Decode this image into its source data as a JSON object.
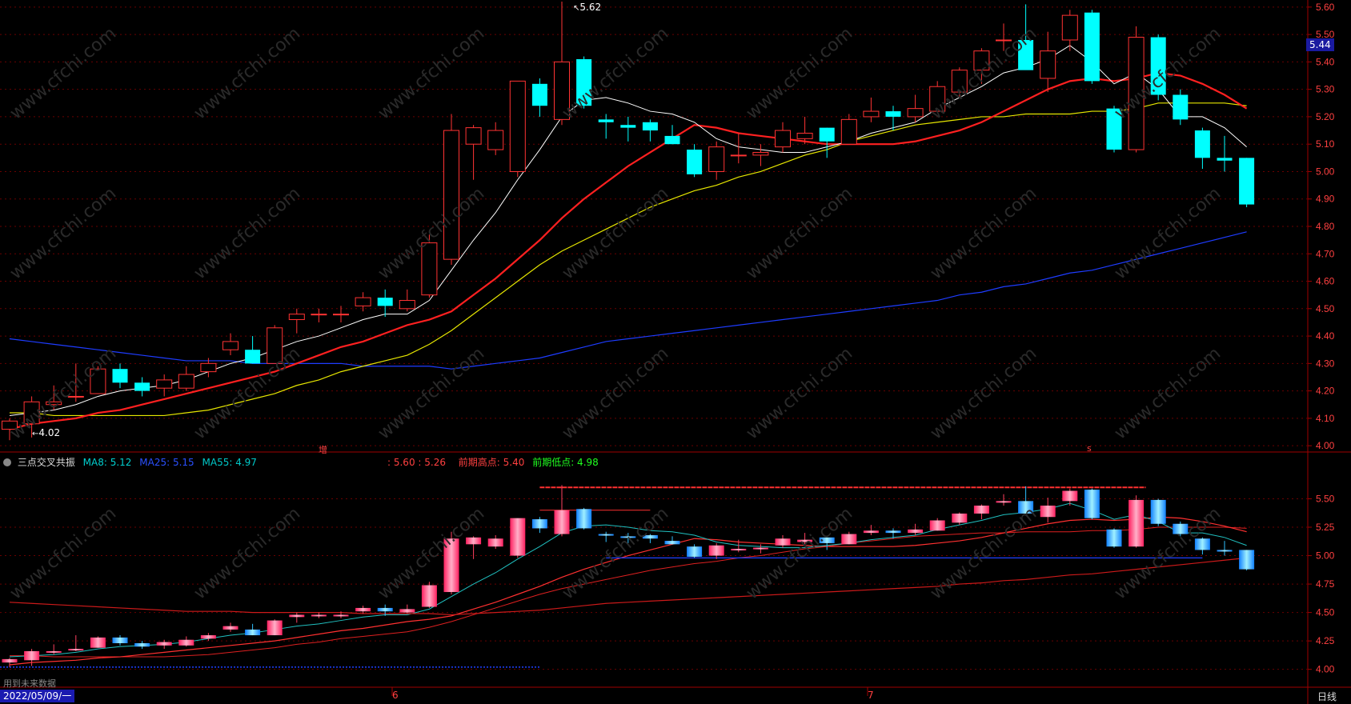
{
  "colors": {
    "up": "#ff3333",
    "down": "#00ffff",
    "ma_white": "#ffffff",
    "ma_red": "#ff2020",
    "ma_yellow": "#e6e600",
    "ma_blue": "#1e3cff",
    "grid": "#6a0000",
    "frame": "#a00000"
  },
  "header": {
    "indicator_name": "三点交叉共振",
    "ma8_label": "MA8: 5.12",
    "ma25_label": "MA25: 5.15",
    "ma55_label": "MA55: 4.97",
    "range_label": ": 5.60 : 5.26",
    "prev_high_label": "前期高点: 5.40",
    "prev_low_label": "前期低点: 4.98"
  },
  "price_badge": "5.44",
  "markers": {
    "high_label": "5.62",
    "low_label": "4.02",
    "signal_zeng": "增",
    "signal_s": "s"
  },
  "footer": {
    "note": "用到未来数据",
    "start_date": "2022/05/09/一",
    "month6": "6",
    "month7": "7",
    "period": "日线"
  },
  "chart_data": [
    {
      "type": "candlestick",
      "panel": "main",
      "ylim": [
        3.98,
        5.62
      ],
      "yticks": [
        4.0,
        4.1,
        4.2,
        4.3,
        4.4,
        4.5,
        4.6,
        4.7,
        4.8,
        4.9,
        5.0,
        5.1,
        5.2,
        5.3,
        5.4,
        5.5,
        5.6
      ],
      "ohlc": [
        [
          4.06,
          4.1,
          4.02,
          4.09
        ],
        [
          4.08,
          4.18,
          4.03,
          4.16
        ],
        [
          4.15,
          4.22,
          4.13,
          4.16
        ],
        [
          4.18,
          4.3,
          4.16,
          4.18
        ],
        [
          4.19,
          4.29,
          4.19,
          4.28
        ],
        [
          4.28,
          4.3,
          4.21,
          4.23
        ],
        [
          4.23,
          4.25,
          4.18,
          4.2
        ],
        [
          4.21,
          4.26,
          4.18,
          4.24
        ],
        [
          4.21,
          4.29,
          4.2,
          4.26
        ],
        [
          4.27,
          4.32,
          4.25,
          4.3
        ],
        [
          4.35,
          4.41,
          4.33,
          4.38
        ],
        [
          4.35,
          4.4,
          4.3,
          4.3
        ],
        [
          4.3,
          4.44,
          4.3,
          4.43
        ],
        [
          4.46,
          4.5,
          4.41,
          4.48
        ],
        [
          4.48,
          4.5,
          4.45,
          4.48
        ],
        [
          4.48,
          4.51,
          4.45,
          4.48
        ],
        [
          4.51,
          4.56,
          4.49,
          4.54
        ],
        [
          4.54,
          4.57,
          4.47,
          4.51
        ],
        [
          4.5,
          4.57,
          4.49,
          4.53
        ],
        [
          4.55,
          4.77,
          4.54,
          4.74
        ],
        [
          4.68,
          5.21,
          4.66,
          5.15
        ],
        [
          5.1,
          5.17,
          4.97,
          5.16
        ],
        [
          5.08,
          5.18,
          5.06,
          5.15
        ],
        [
          5.0,
          5.21,
          4.98,
          5.33
        ],
        [
          5.32,
          5.34,
          5.2,
          5.24
        ],
        [
          5.19,
          5.62,
          5.17,
          5.4
        ],
        [
          5.41,
          5.42,
          5.23,
          5.24
        ],
        [
          5.19,
          5.21,
          5.12,
          5.18
        ],
        [
          5.17,
          5.2,
          5.11,
          5.16
        ],
        [
          5.18,
          5.19,
          5.11,
          5.15
        ],
        [
          5.13,
          5.17,
          5.1,
          5.1
        ],
        [
          5.08,
          5.1,
          4.98,
          4.99
        ],
        [
          5.0,
          5.11,
          4.97,
          5.09
        ],
        [
          5.06,
          5.14,
          5.03,
          5.06
        ],
        [
          5.06,
          5.1,
          5.02,
          5.07
        ],
        [
          5.09,
          5.18,
          5.07,
          5.15
        ],
        [
          5.12,
          5.2,
          5.1,
          5.14
        ],
        [
          5.16,
          5.16,
          5.05,
          5.11
        ],
        [
          5.1,
          5.21,
          5.1,
          5.19
        ],
        [
          5.2,
          5.27,
          5.18,
          5.22
        ],
        [
          5.22,
          5.24,
          5.15,
          5.2
        ],
        [
          5.2,
          5.28,
          5.18,
          5.23
        ],
        [
          5.22,
          5.33,
          5.22,
          5.31
        ],
        [
          5.29,
          5.38,
          5.27,
          5.37
        ],
        [
          5.37,
          5.45,
          5.32,
          5.44
        ],
        [
          5.48,
          5.54,
          5.44,
          5.48
        ],
        [
          5.48,
          5.61,
          5.38,
          5.37
        ],
        [
          5.34,
          5.51,
          5.29,
          5.44
        ],
        [
          5.48,
          5.59,
          5.44,
          5.57
        ],
        [
          5.58,
          5.59,
          5.32,
          5.33
        ],
        [
          5.23,
          5.24,
          5.07,
          5.08
        ],
        [
          5.08,
          5.53,
          5.07,
          5.49
        ],
        [
          5.49,
          5.5,
          5.26,
          5.28
        ],
        [
          5.28,
          5.3,
          5.17,
          5.19
        ],
        [
          5.15,
          5.16,
          5.01,
          5.05
        ],
        [
          5.05,
          5.13,
          5.0,
          5.04
        ],
        [
          5.05,
          5.05,
          4.87,
          4.88
        ]
      ],
      "ma8": [
        4.11,
        4.12,
        4.13,
        4.15,
        4.18,
        4.2,
        4.21,
        4.22,
        4.24,
        4.27,
        4.3,
        4.32,
        4.35,
        4.38,
        4.4,
        4.43,
        4.46,
        4.48,
        4.48,
        4.53,
        4.64,
        4.75,
        4.85,
        4.97,
        5.08,
        5.2,
        5.26,
        5.27,
        5.25,
        5.22,
        5.21,
        5.18,
        5.12,
        5.09,
        5.08,
        5.07,
        5.07,
        5.09,
        5.11,
        5.14,
        5.16,
        5.18,
        5.23,
        5.27,
        5.31,
        5.36,
        5.38,
        5.41,
        5.46,
        5.4,
        5.32,
        5.36,
        5.3,
        5.2,
        5.2,
        5.16,
        5.09
      ],
      "ma25": [
        4.06,
        4.08,
        4.09,
        4.1,
        4.12,
        4.13,
        4.15,
        4.17,
        4.19,
        4.21,
        4.23,
        4.25,
        4.27,
        4.3,
        4.33,
        4.36,
        4.38,
        4.41,
        4.44,
        4.46,
        4.49,
        4.55,
        4.61,
        4.68,
        4.75,
        4.83,
        4.9,
        4.96,
        5.02,
        5.07,
        5.12,
        5.17,
        5.16,
        5.14,
        5.13,
        5.12,
        5.11,
        5.1,
        5.1,
        5.1,
        5.1,
        5.11,
        5.13,
        5.15,
        5.18,
        5.22,
        5.26,
        5.3,
        5.33,
        5.34,
        5.33,
        5.34,
        5.36,
        5.35,
        5.32,
        5.28,
        5.23
      ],
      "ma55": [
        4.12,
        4.12,
        4.11,
        4.11,
        4.11,
        4.11,
        4.11,
        4.11,
        4.12,
        4.13,
        4.15,
        4.17,
        4.19,
        4.22,
        4.24,
        4.27,
        4.29,
        4.31,
        4.33,
        4.37,
        4.42,
        4.48,
        4.54,
        4.6,
        4.66,
        4.71,
        4.75,
        4.79,
        4.83,
        4.87,
        4.9,
        4.93,
        4.95,
        4.98,
        5.0,
        5.03,
        5.06,
        5.08,
        5.11,
        5.13,
        5.15,
        5.17,
        5.18,
        5.19,
        5.2,
        5.2,
        5.21,
        5.21,
        5.21,
        5.22,
        5.22,
        5.23,
        5.25,
        5.25,
        5.25,
        5.25,
        5.24
      ],
      "ma_long": [
        4.39,
        4.38,
        4.37,
        4.36,
        4.35,
        4.34,
        4.33,
        4.32,
        4.31,
        4.31,
        4.31,
        4.3,
        4.3,
        4.3,
        4.3,
        4.3,
        4.29,
        4.29,
        4.29,
        4.29,
        4.28,
        4.29,
        4.3,
        4.31,
        4.32,
        4.34,
        4.36,
        4.38,
        4.39,
        4.4,
        4.41,
        4.42,
        4.43,
        4.44,
        4.45,
        4.46,
        4.47,
        4.48,
        4.49,
        4.5,
        4.51,
        4.52,
        4.53,
        4.55,
        4.56,
        4.58,
        4.59,
        4.61,
        4.63,
        4.64,
        4.66,
        4.68,
        4.7,
        4.72,
        4.74,
        4.76,
        4.78
      ]
    },
    {
      "type": "candlestick",
      "panel": "indicator",
      "ylim": [
        3.85,
        5.82
      ],
      "yticks": [
        4.0,
        4.25,
        4.5,
        4.75,
        5.0,
        5.25,
        5.5
      ],
      "series": [
        "MA8",
        "MA25",
        "MA55"
      ],
      "levels": {
        "upper": 5.6,
        "mid_high": 5.4,
        "support": 4.98,
        "low": 4.02
      }
    }
  ]
}
